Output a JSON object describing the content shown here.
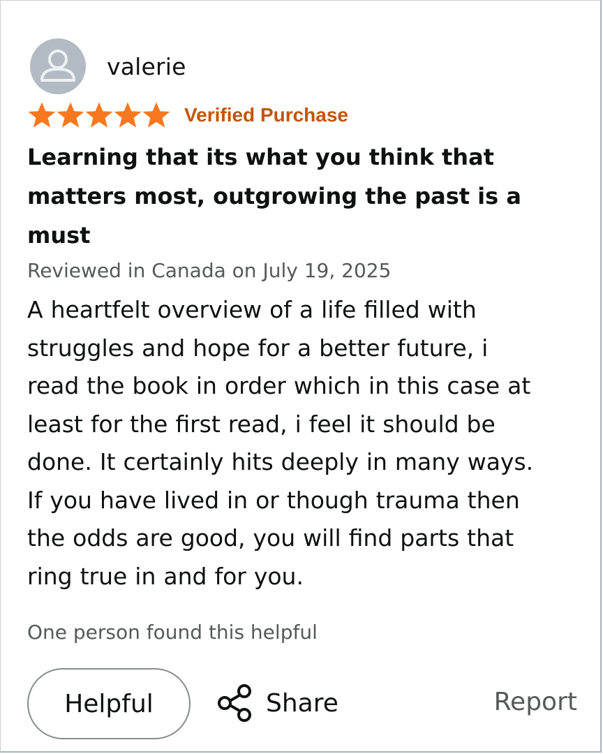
{
  "reviewer": {
    "name": "valerie",
    "avatar_icon": "person-icon"
  },
  "rating": {
    "stars": 5,
    "max": 5,
    "star_color": "#f7781f",
    "verified_label": "Verified Purchase",
    "verified_color": "#c45500"
  },
  "review": {
    "title": "Learning that its what you think that matters most, outgrowing the past is a must",
    "meta": "Reviewed in Canada on July 19, 2025",
    "body_lines": [
      "A heartfelt overview of a life filled with",
      "struggles and hope for a better future, i",
      "read the book in order which in this case at",
      "least for the first read, i feel it should be",
      "done. It certainly hits deeply in many ways.",
      "If you have lived in or though trauma then",
      "the odds are good, you will find parts that",
      "ring true in and for you."
    ],
    "helpful_count_text": "One person found this helpful"
  },
  "actions": {
    "helpful_label": "Helpful",
    "share_label": "Share",
    "share_icon": "share-icon",
    "report_label": "Report"
  }
}
